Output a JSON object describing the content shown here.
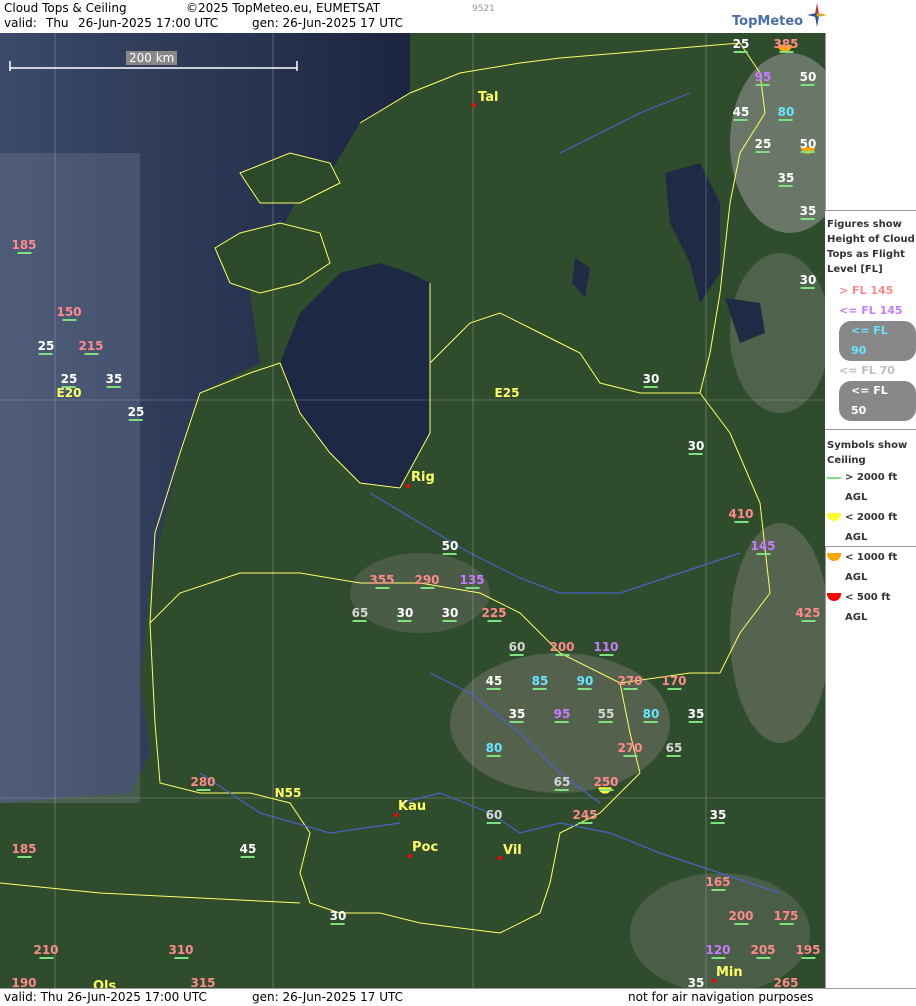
{
  "header": {
    "title": "Cloud Tops & Ceiling",
    "copyright": "©2025 TopMeteo.eu, EUMETSAT",
    "code": "9521",
    "valid_label": "valid:",
    "valid_day": "Thu",
    "valid_date": "26-Jun-2025",
    "valid_time": "17:00 UTC",
    "gen": "gen: 26-Jun-2025 17 UTC",
    "logo": "TopMeteo"
  },
  "scale": {
    "label": "200 km"
  },
  "cities": [
    {
      "name": "Tal"
    },
    {
      "name": "Rig"
    },
    {
      "name": "Kau"
    },
    {
      "name": "Poc"
    },
    {
      "name": "Vil"
    },
    {
      "name": "Min"
    },
    {
      "name": "Ols"
    }
  ],
  "roads": [
    {
      "name": "E25"
    },
    {
      "name": "E20"
    },
    {
      "name": "N55"
    }
  ],
  "values": [
    {
      "v": "25",
      "c": "white"
    },
    {
      "v": "385",
      "c": "pink"
    },
    {
      "v": "95",
      "c": "purple"
    },
    {
      "v": "50",
      "c": "white"
    },
    {
      "v": "45",
      "c": "white"
    },
    {
      "v": "80",
      "c": "cyan"
    },
    {
      "v": "25",
      "c": "white"
    },
    {
      "v": "50",
      "c": "white"
    },
    {
      "v": "35",
      "c": "white"
    },
    {
      "v": "35",
      "c": "white"
    },
    {
      "v": "30",
      "c": "white"
    },
    {
      "v": "185",
      "c": "pink"
    },
    {
      "v": "150",
      "c": "pink"
    },
    {
      "v": "25",
      "c": "white"
    },
    {
      "v": "215",
      "c": "pink"
    },
    {
      "v": "25",
      "c": "white"
    },
    {
      "v": "35",
      "c": "white"
    },
    {
      "v": "25",
      "c": "white"
    },
    {
      "v": "30",
      "c": "white"
    },
    {
      "v": "30",
      "c": "white"
    },
    {
      "v": "410",
      "c": "pink"
    },
    {
      "v": "145",
      "c": "purple"
    },
    {
      "v": "50",
      "c": "white"
    },
    {
      "v": "355",
      "c": "pink"
    },
    {
      "v": "290",
      "c": "pink"
    },
    {
      "v": "135",
      "c": "purple"
    },
    {
      "v": "425",
      "c": "pink"
    },
    {
      "v": "65",
      "c": "gray"
    },
    {
      "v": "30",
      "c": "white"
    },
    {
      "v": "30",
      "c": "white"
    },
    {
      "v": "225",
      "c": "pink"
    },
    {
      "v": "60",
      "c": "gray"
    },
    {
      "v": "200",
      "c": "pink"
    },
    {
      "v": "110",
      "c": "purple"
    },
    {
      "v": "45",
      "c": "white"
    },
    {
      "v": "85",
      "c": "cyan"
    },
    {
      "v": "90",
      "c": "cyan"
    },
    {
      "v": "270",
      "c": "pink"
    },
    {
      "v": "170",
      "c": "pink"
    },
    {
      "v": "35",
      "c": "white"
    },
    {
      "v": "95",
      "c": "purple"
    },
    {
      "v": "55",
      "c": "gray"
    },
    {
      "v": "80",
      "c": "cyan"
    },
    {
      "v": "35",
      "c": "white"
    },
    {
      "v": "80",
      "c": "cyan"
    },
    {
      "v": "270",
      "c": "pink"
    },
    {
      "v": "65",
      "c": "gray"
    },
    {
      "v": "280",
      "c": "pink"
    },
    {
      "v": "65",
      "c": "gray"
    },
    {
      "v": "250",
      "c": "pink"
    },
    {
      "v": "60",
      "c": "gray"
    },
    {
      "v": "245",
      "c": "pink"
    },
    {
      "v": "35",
      "c": "white"
    },
    {
      "v": "185",
      "c": "pink"
    },
    {
      "v": "45",
      "c": "white"
    },
    {
      "v": "165",
      "c": "pink"
    },
    {
      "v": "30",
      "c": "white"
    },
    {
      "v": "200",
      "c": "pink"
    },
    {
      "v": "175",
      "c": "pink"
    },
    {
      "v": "210",
      "c": "pink"
    },
    {
      "v": "310",
      "c": "pink"
    },
    {
      "v": "120",
      "c": "purple"
    },
    {
      "v": "205",
      "c": "pink"
    },
    {
      "v": "195",
      "c": "pink"
    },
    {
      "v": "190",
      "c": "pink"
    },
    {
      "v": "315",
      "c": "pink"
    },
    {
      "v": "35",
      "c": "white"
    },
    {
      "v": "265",
      "c": "pink"
    }
  ],
  "legend": {
    "tops_title": [
      "Figures show",
      "Height of Cloud",
      "Tops as Flight",
      "Level  [FL]"
    ],
    "tops_rows": [
      {
        "label": "> FL 145",
        "color": "#ff8a8a"
      },
      {
        "label": "<= FL 145",
        "color": "#c77dff"
      },
      {
        "label": "<= FL 90",
        "color": "#66e6ff"
      },
      {
        "label": "<= FL 70",
        "color": "#bdbdbd"
      },
      {
        "label": "<= FL 50",
        "color": "#ffffff"
      }
    ],
    "ceiling_title": [
      "Symbols show",
      "Ceiling"
    ],
    "ceiling_rows": [
      {
        "label": "> 2000 ft AGL",
        "color": "#7fe07f"
      },
      {
        "label": "< 2000 ft AGL",
        "color": "#ffff33"
      },
      {
        "label": "< 1000 ft AGL",
        "color": "#ffa500"
      },
      {
        "label": "< 500 ft AGL",
        "color": "#ff0000"
      }
    ]
  },
  "footer": {
    "valid": "valid:  Thu   26-Jun-2025   17:00 UTC",
    "gen": "gen: 26-Jun-2025 17 UTC",
    "note": "not for air navigation purposes"
  }
}
